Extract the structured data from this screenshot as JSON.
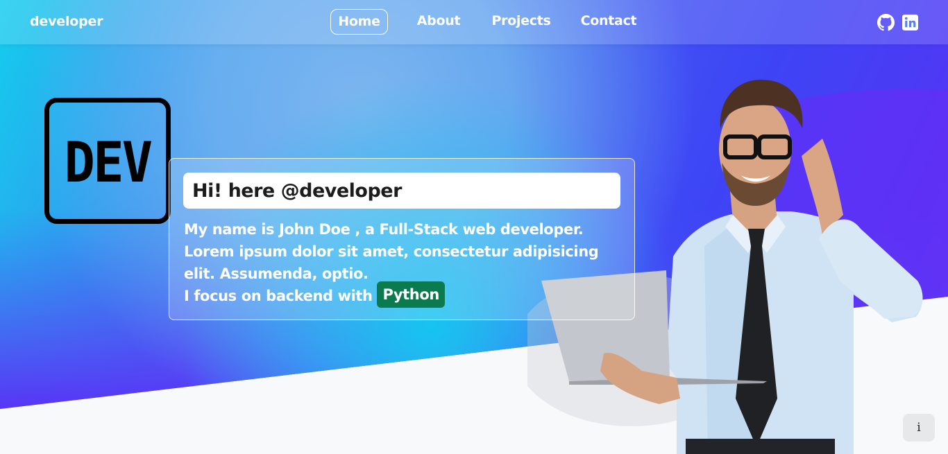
{
  "navbar": {
    "brand": "developer",
    "links": [
      {
        "label": "Home",
        "active": true
      },
      {
        "label": "About"
      },
      {
        "label": "Projects"
      },
      {
        "label": "Contact"
      }
    ],
    "social_icons": [
      "github-icon",
      "linkedin-icon"
    ]
  },
  "logo": {
    "text": "DEV"
  },
  "intro": {
    "greeting": "Hi! here @developer",
    "line1": "My name is John Doe , a Full-Stack web developer.",
    "line2": "Lorem ipsum dolor sit amet, consectetur adipisicing",
    "line3": "elit. Assumenda, optio.",
    "focus_prefix": "I focus on backend with",
    "focus_tech": "Python"
  },
  "info_button": {
    "label": "i"
  },
  "colors": {
    "gradient_cyan": "#17c8ee",
    "gradient_blue": "#3f4cf5",
    "gradient_purple": "#6a2cf6",
    "badge_green": "#0b7a4e",
    "page_bottom": "#f7f9fb"
  }
}
